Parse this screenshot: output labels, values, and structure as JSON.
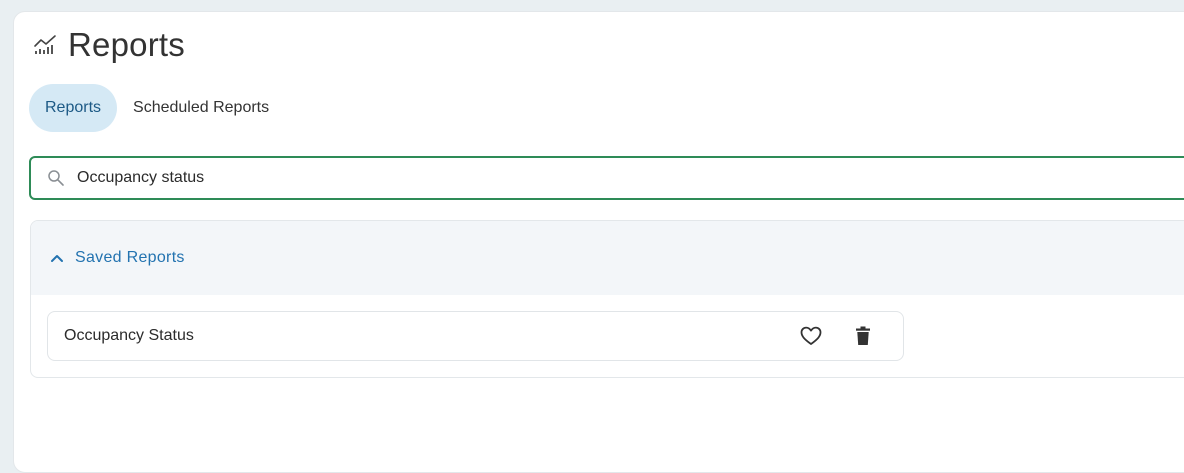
{
  "page": {
    "title": "Reports",
    "title_icon": "chart-trend-icon"
  },
  "tabs": [
    {
      "label": "Reports",
      "active": true
    },
    {
      "label": "Scheduled Reports",
      "active": false
    }
  ],
  "search": {
    "value": "Occupancy status",
    "icon": "search-icon"
  },
  "saved_reports": {
    "title": "Saved Reports",
    "expanded": true,
    "items": [
      {
        "name": "Occupancy Status",
        "favorite_icon": "heart-outline-icon",
        "delete_icon": "trash-icon"
      }
    ]
  },
  "colors": {
    "accent": "#2373b0",
    "active_tab_bg": "#d5e9f5",
    "search_border": "#2e8b57",
    "background": "#e9eff2"
  }
}
